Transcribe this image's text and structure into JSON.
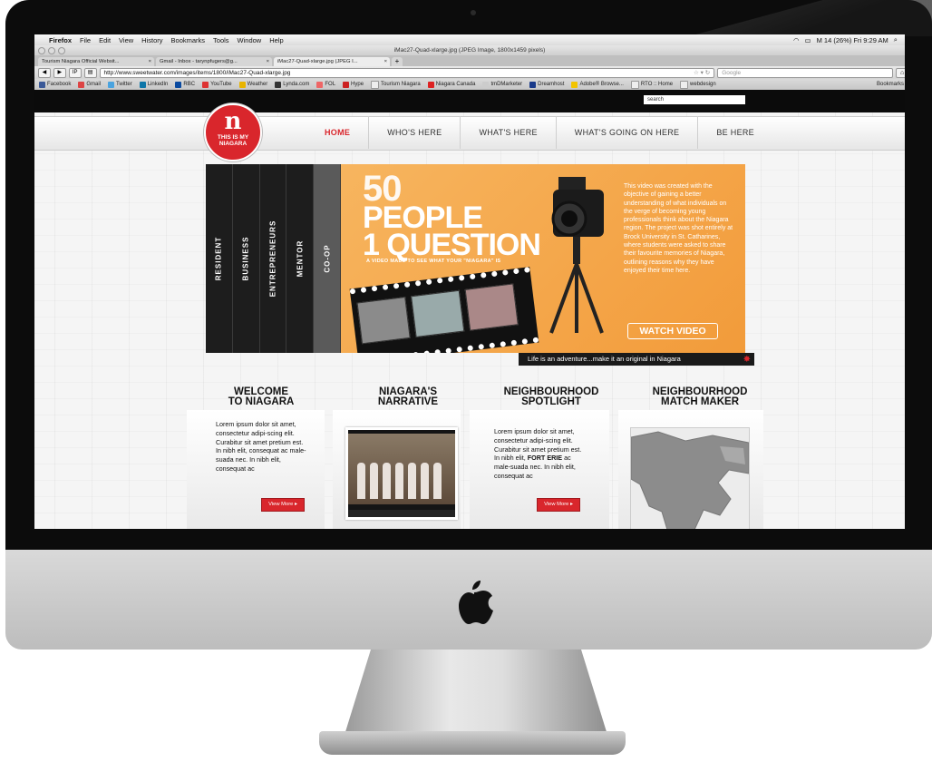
{
  "mac_menubar": {
    "app": "Firefox",
    "menus": [
      "File",
      "Edit",
      "View",
      "History",
      "Bookmarks",
      "Tools",
      "Window",
      "Help"
    ],
    "status": "M 14  (26%)  Fri 9:29 AM"
  },
  "browser": {
    "window_title": "iMac27-Quad-xlarge.jpg (JPEG Image, 1800x1459 pixels)",
    "tabs": [
      {
        "label": "Tourism Niagara Official Websit..."
      },
      {
        "label": "Gmail - Inbox - tarynpfugers@g..."
      },
      {
        "label": "iMac27-Quad-xlarge.jpg (JPEG I..."
      }
    ],
    "url": "http://www.sweetwater.com/images/items/1800/iMac27-Quad-xlarge.jpg",
    "search_placeholder": "Google",
    "bookmarks": [
      "Facebook",
      "Gmail",
      "Twitter",
      "LinkedIn",
      "RBC",
      "YouTube",
      "Weather",
      "Lynda.com",
      "FOL",
      "Hype",
      "Tourism Niagara",
      "Niagara Canada",
      "tmDMarketer",
      "Dreamhost",
      "Adobe® Browse...",
      "RTO :: Home",
      "webdesign"
    ],
    "bookmarks_menu": "Bookmarks"
  },
  "site": {
    "search_placeholder": "search",
    "logo": {
      "letter": "n",
      "line1": "THIS IS MY",
      "line2": "NIAGARA"
    },
    "nav": [
      "HOME",
      "WHO'S HERE",
      "WHAT'S HERE",
      "WHAT'S GOING ON HERE",
      "BE HERE"
    ],
    "side_tabs": [
      "RESIDENT",
      "BUSINESS",
      "ENTREPRENEURS",
      "MENTOR",
      "CO-OP"
    ],
    "banner": {
      "line1": "50",
      "line2": "PEOPLE",
      "line3": "1 QUESTION",
      "sub": "A VIDEO MADE TO SEE WHAT YOUR \"NIAGARA\" IS",
      "description": "This video was created with the objective of gaining a better understanding of what individuals on the verge of becoming young professionals think about the Niagara region. The project was shot entirely at Brock University in St. Catharines, where students were asked to share their favourite memories of Niagara, outlining reasons why they have enjoyed their time here.",
      "cta": "WATCH VIDEO"
    },
    "tagline": "Life is an adventure...make it an original in Niagara",
    "sections": [
      {
        "title_line1": "WELCOME",
        "title_line2": "TO NIAGARA"
      },
      {
        "title_line1": "NIAGARA'S",
        "title_line2": "NARRATIVE"
      },
      {
        "title_line1": "NEIGHBOURHOOD",
        "title_line2": "SPOTLIGHT"
      },
      {
        "title_line1": "NEIGHBOURHOOD",
        "title_line2": "MATCH MAKER"
      }
    ],
    "welcome_text": "Lorem ipsum dolor sit amet, consectetur adipi-scing elit. Curabitur sit amet pretium est. In nibh elit, consequat ac male-suada nec. In nibh elit, consequat ac",
    "spotlight_text_before": "Lorem ipsum dolor sit amet, consectetur adipi-scing elit. Curabitur sit amet pretium est. In nibh elit,",
    "spotlight_bold": "FORT ERIE",
    "spotlight_text_after": "ac male-suada nec. In nibh elit, consequat ac",
    "view_more": "View More ▸"
  }
}
